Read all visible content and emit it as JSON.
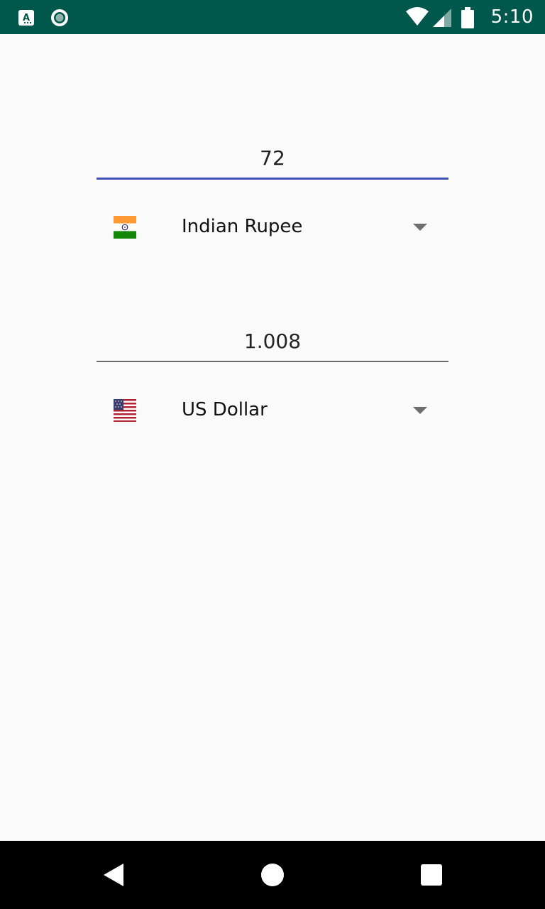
{
  "status_bar": {
    "time": "5:10",
    "left_icons": [
      "accessibility-app-icon",
      "radio-circle-icon"
    ],
    "right_icons": [
      "wifi-icon",
      "cell-signal-icon",
      "battery-icon"
    ],
    "bg_color": "#00574b"
  },
  "converter": {
    "from": {
      "amount": "72",
      "currency": "Indian Rupee",
      "flag_icon": "india-flag-icon"
    },
    "to": {
      "amount": "1.008",
      "currency": "US Dollar",
      "flag_icon": "us-flag-icon"
    },
    "accent_color": "#3f51b5"
  },
  "nav_bar": {
    "buttons": [
      "back-icon",
      "home-icon",
      "recents-icon"
    ]
  }
}
